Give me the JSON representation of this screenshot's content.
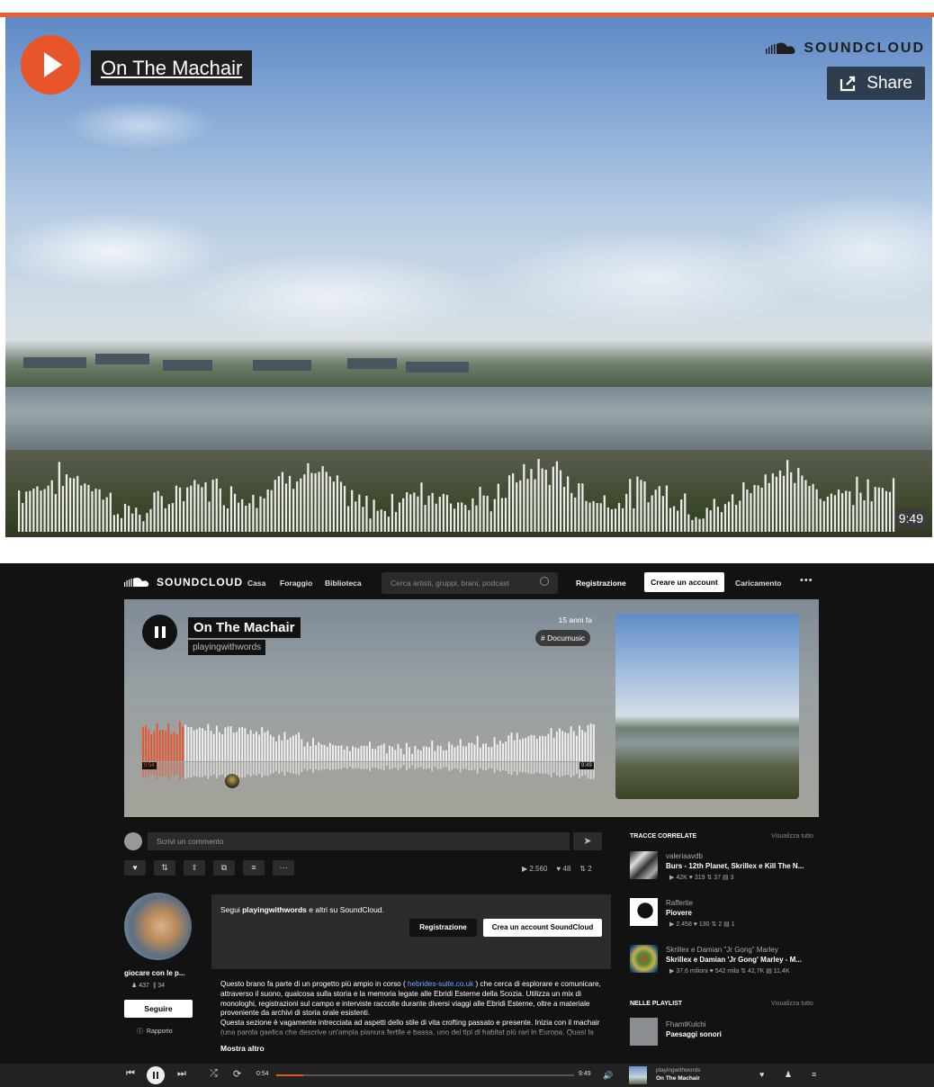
{
  "embed": {
    "title": "On The Machair",
    "brand": "SOUNDCLOUD",
    "share_label": "Share",
    "duration": "9:49"
  },
  "nav": {
    "brand": "SOUNDCLOUD",
    "links": [
      "Casa",
      "Foraggio",
      "Biblioteca"
    ],
    "search_placeholder": "Cerca artisti, gruppi, brani, podcast",
    "signin": "Registrazione",
    "create_account": "Creare un account",
    "upload": "Caricamento",
    "more": "•••"
  },
  "track": {
    "title": "On The Machair",
    "artist": "playingwithwords",
    "posted": "15 anni fa",
    "tag": "# Documusic",
    "current_time": "0:54",
    "total_time": "9:49",
    "progress": 0.092
  },
  "comment": {
    "placeholder": "Scrivi un commento"
  },
  "actions": {
    "stats": {
      "plays": "▶ 2.560",
      "likes": "♥ 48",
      "reposts": "⇅ 2"
    }
  },
  "profile": {
    "name": "giocare con le p...",
    "followers": "437",
    "tracks": "34",
    "follow_label": "Seguire",
    "report_label": "Rapporto"
  },
  "signup": {
    "text_prefix": "Segui ",
    "text_user": "playingwithwords",
    "text_suffix": " e altri su SoundCloud.",
    "signin": "Registrazione",
    "create": "Crea un account SoundCloud"
  },
  "description": {
    "p1_a": "Questo brano fa parte di un progetto più ampio in corso ( ",
    "p1_link": "hebrides-suite.co.uk",
    "p1_b": " ) che cerca di esplorare e comunicare, attraverso il suono, qualcosa sulla storia e la memoria legate alle Ebridi Esterne della Scozia. Utilizza un mix di monologhi, registrazioni sul campo e interviste raccolte durante diversi viaggi alle Ebridi Esterne, oltre a materiale proveniente da archivi di storia orale esistenti.",
    "p2": "Questa sezione è vagamente intrecciata ad aspetti dello stile di vita crofting passato e presente. Inizia con il machair (una parola gaelica che descrive un'ampia pianura fertile e bassa, uno dei tipi di habitat più rari in Europa. Quasi la metà di tutto il machair scozzese si trova nelle Ebridi Esterne) e in particolare il machair",
    "show_more": "Mostra altro"
  },
  "sidebar": {
    "related_heading": "TRACCE CORRELATE",
    "related_all": "Visualizza tutto",
    "related": [
      {
        "user": "valeriaavdb",
        "title": "Burs - 12th Planet, Skrillex e Kill The N...",
        "stats": "▶ 42K  ♥ 319  ⇅ 37  ▤ 3"
      },
      {
        "user": "Raffertie",
        "title": "Piovere",
        "stats": "▶ 2.458  ♥ 130  ⇅ 2  ▤ 1"
      },
      {
        "user": "Skrillex e Damian \"Jr Gong\" Marley",
        "title": "Skrillex e Damian 'Jr Gong' Marley - M...",
        "stats": "▶ 37,6 milioni  ♥ 542 mila  ⇅ 42,7K  ▤ 11,4K"
      }
    ],
    "playlist_heading": "NELLE PLAYLIST",
    "playlist_all": "Visualizza tutto",
    "playlists": [
      {
        "user": "FhamtKulchi",
        "title": "Paesaggi sonori"
      }
    ]
  },
  "player": {
    "current_time": "0:54",
    "total_time": "9:49",
    "progress": 0.092,
    "mini_user": "playingwithwords",
    "mini_title": "On The Machair"
  },
  "colors": {
    "accent": "#e8552b",
    "background": "#121212"
  }
}
